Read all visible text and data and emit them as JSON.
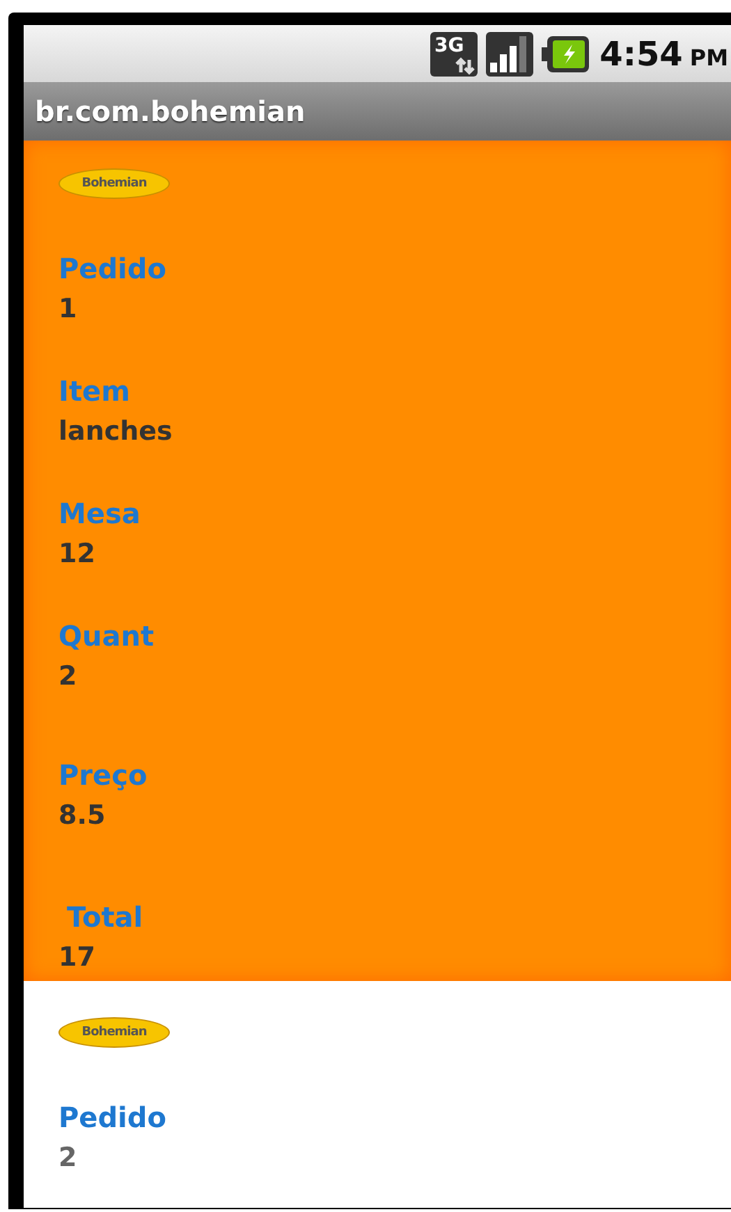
{
  "status_bar": {
    "network": "3G",
    "time": "4:54",
    "ampm": "PM"
  },
  "title_bar": {
    "title": "br.com.bohemian"
  },
  "orders": [
    {
      "selected": true,
      "logo_text": "Bohemian",
      "fields": [
        {
          "label": "Pedido",
          "value": "1"
        },
        {
          "label": "Item",
          "value": "lanches"
        },
        {
          "label": "Mesa",
          "value": "12"
        },
        {
          "label": "Quant",
          "value": "2"
        },
        {
          "label": "Preço",
          "value": "8.5"
        },
        {
          "label": "Total",
          "value": "17"
        }
      ]
    },
    {
      "selected": false,
      "logo_text": "Bohemian",
      "fields": [
        {
          "label": "Pedido",
          "value": "2"
        }
      ]
    }
  ]
}
